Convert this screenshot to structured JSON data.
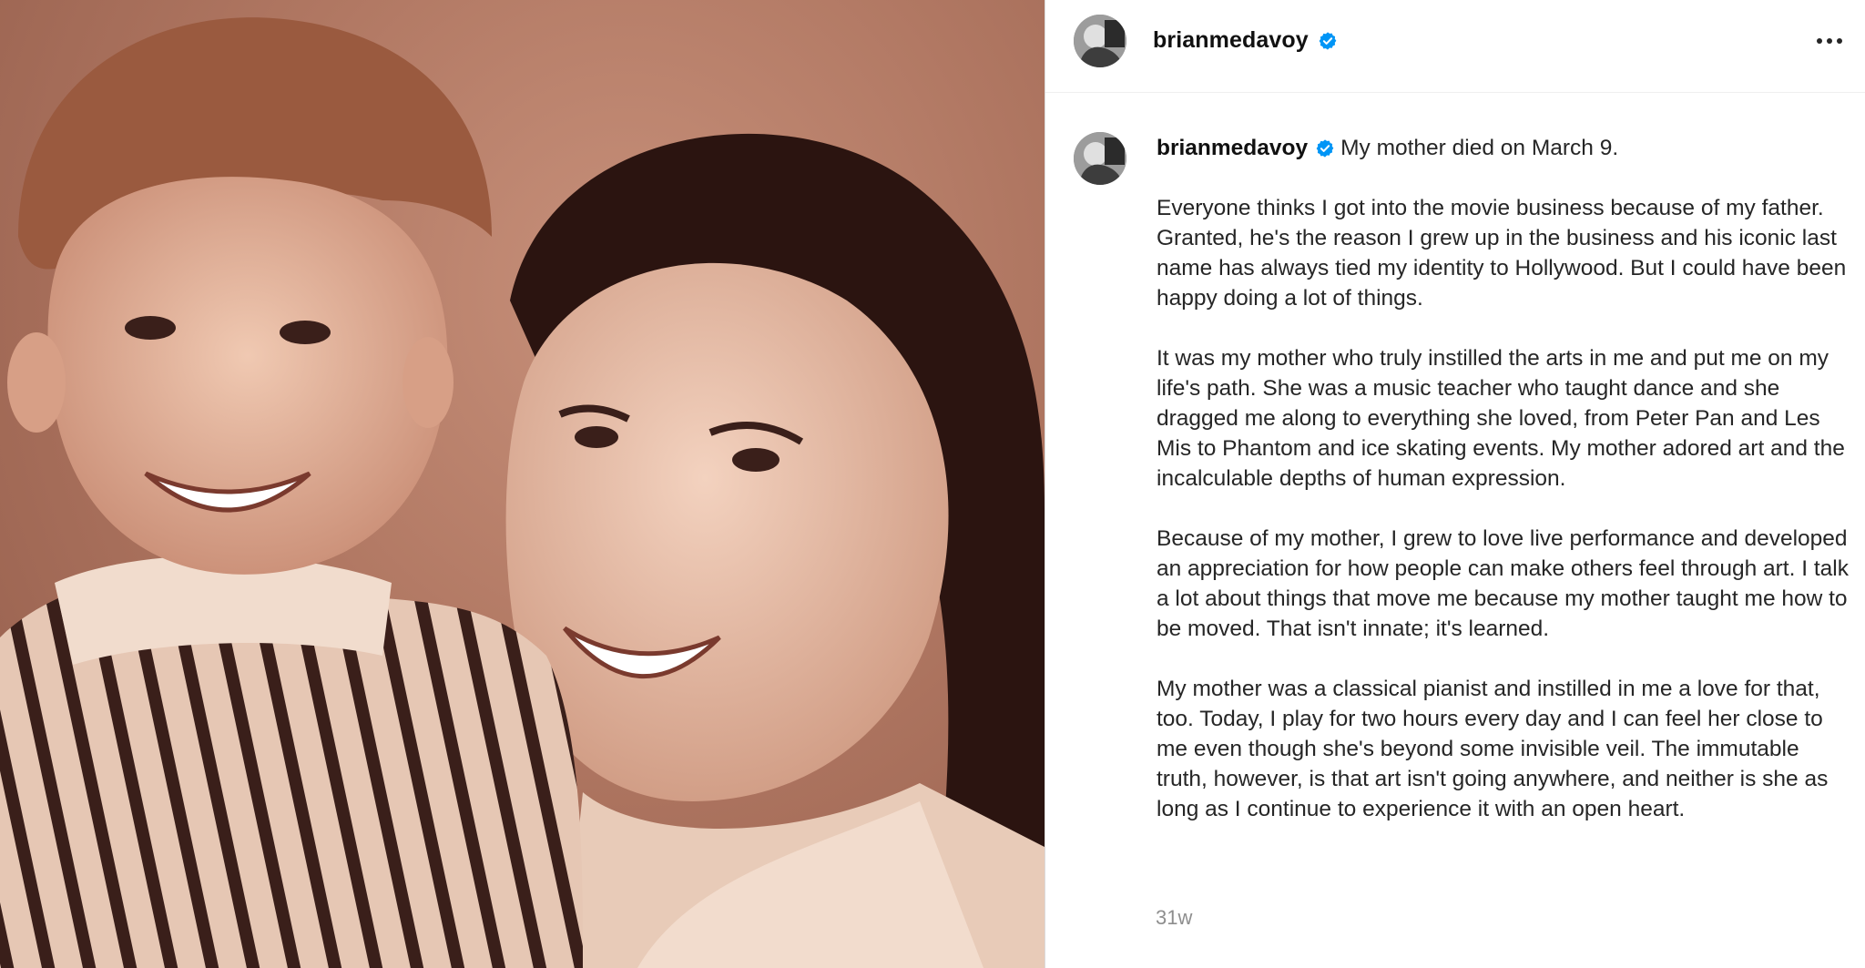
{
  "post": {
    "username": "brianmedavoy",
    "verified": true,
    "caption_first_line": "My mother died on March 9.",
    "paragraphs": [
      "Everyone thinks I got into the movie business because of my father. Granted, he's the reason I grew up in the business and his iconic last name has always tied my identity to Hollywood. But I could have been happy doing a lot of things.",
      "It was my mother who truly instilled the arts in me and put me on my life's path. She was a music teacher who taught dance and she dragged me along to everything she loved, from Peter Pan and Les Mis to Phantom and ice skating events. My mother adored art and the incalculable depths of human expression.",
      "Because of my mother, I grew to love live performance and developed an appreciation for how people can make others feel through art. I talk a lot about things that move me because my mother taught me how to be moved. That isn't innate; it's learned.",
      "My mother was a classical pianist and instilled in me a love for that, too. Today, I play for two hours every day and I can feel her close to me even though she's beyond some invisible veil. The immutable truth, however, is that art isn't going anywhere, and neither is she as long as I continue to experience it with an open heart."
    ],
    "timestamp": "31w"
  },
  "icons": {
    "verified": "verified-badge-icon",
    "more": "more-options-icon"
  },
  "colors": {
    "verified_blue": "#0095f6",
    "timestamp_gray": "#8e8e8e",
    "divider": "#efefef",
    "photo_sepia": "#b07762"
  }
}
